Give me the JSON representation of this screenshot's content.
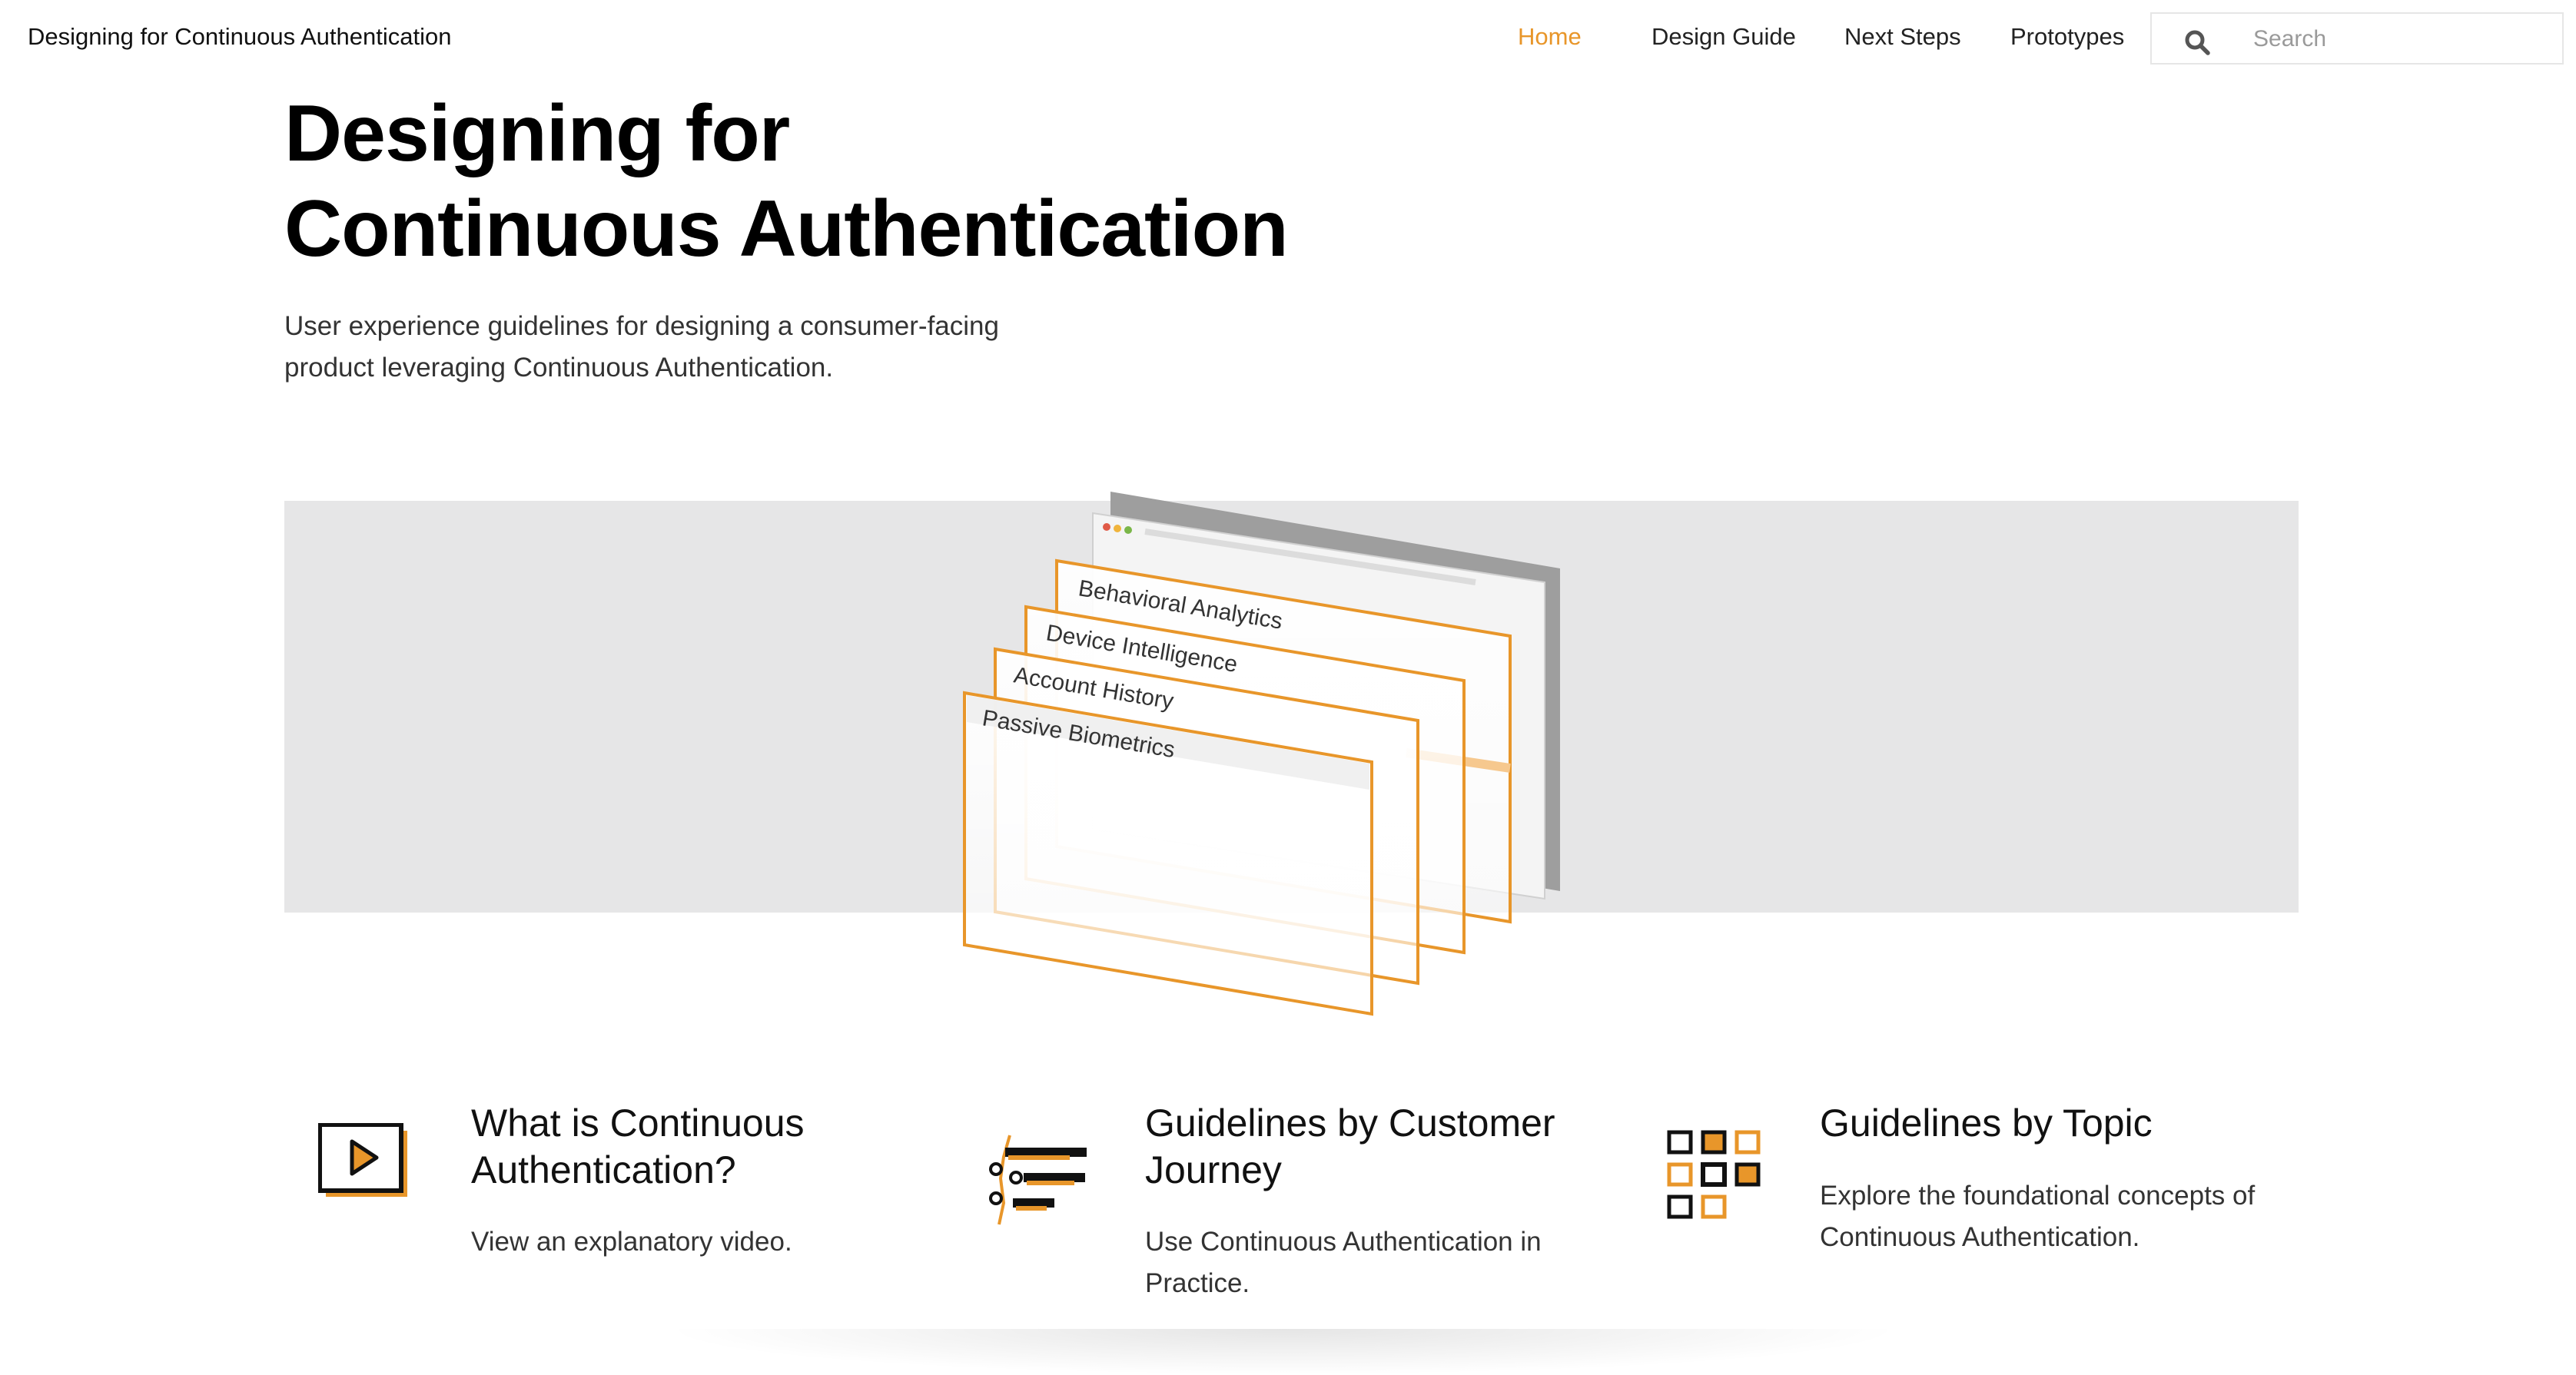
{
  "header": {
    "site_title": "Designing for Continuous Authentication",
    "nav": [
      {
        "label": "Home",
        "active": true
      },
      {
        "label": "Design Guide",
        "active": false
      },
      {
        "label": "Next Steps",
        "active": false
      },
      {
        "label": "Prototypes",
        "active": false
      }
    ],
    "search": {
      "placeholder": "Search",
      "value": "",
      "icon": "search-icon"
    }
  },
  "hero": {
    "title_line1": "Designing for",
    "title_line2": "Continuous Authentication",
    "subtitle_line1": "User experience guidelines for designing a consumer-facing",
    "subtitle_line2": "product leveraging Continuous Authentication."
  },
  "illustration": {
    "layers": [
      "Behavioral Analytics",
      "Device Intelligence",
      "Account History",
      "Passive Biometrics"
    ]
  },
  "cards": [
    {
      "icon": "play-video-icon",
      "title_line1": "What is Continuous",
      "title_line2": "Authentication?",
      "desc_line1": "View an explanatory video.",
      "desc_line2": ""
    },
    {
      "icon": "journey-list-icon",
      "title_line1": "Guidelines by Customer",
      "title_line2": "Journey",
      "desc_line1": "Use Continuous Authentication in",
      "desc_line2": "Practice."
    },
    {
      "icon": "topic-grid-icon",
      "title_line1": "Guidelines by Topic",
      "title_line2": "",
      "desc_line1": "Explore the foundational concepts of",
      "desc_line2": "Continuous Authentication."
    }
  ],
  "colors": {
    "accent": "#e8962a",
    "banner_bg": "#e6e6e7",
    "text": "#111111"
  }
}
